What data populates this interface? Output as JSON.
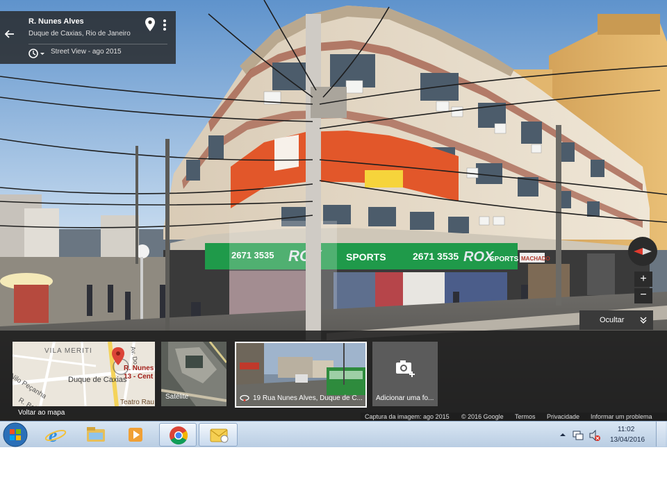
{
  "header": {
    "back_icon": "arrow-left-icon",
    "title": "R. Nunes Alves",
    "subtitle": "Duque de Caxias, Rio de Janeiro",
    "date_label": "Street View - ago 2015",
    "pin_icon": "location-pin-icon",
    "more_icon": "more-vertical-icon",
    "history_icon": "clock-history-icon"
  },
  "storefront": {
    "sign_left_phone": "2671 3535",
    "sign_brand": "ROX",
    "sign_sports": "SPORTS",
    "sign_phone": "2671 3535",
    "sign_right_brand": "ROX",
    "sign_right_sports": "SPORTS",
    "shop_small_sign": "MACHADO"
  },
  "controls": {
    "zoom_in": "+",
    "zoom_out": "−",
    "hide_label": "Ocultar"
  },
  "thumbnails": {
    "map": {
      "street_1": "VILA MERITI",
      "street_2": "Nilo Peçanha",
      "street_3": "Av. Do",
      "place_1": "R. Nunes",
      "place_2": "13 - Cent",
      "place_3": "Duque de Caxias",
      "place_4": "Teatro Rau",
      "street_4": "R. Bel",
      "back_label": "Voltar ao mapa"
    },
    "satellite_label": "Satélite",
    "photo_label": "19 Rua Nunes Alves, Duque de C...",
    "add_photo_label": "Adicionar uma fo..."
  },
  "attribution": {
    "capture": "Captura da imagem: ago 2015",
    "copyright": "© 2016 Google",
    "terms": "Termos",
    "privacy": "Privacidade",
    "report": "Informar um problema"
  },
  "taskbar": {
    "time": "11:02",
    "date": "13/04/2016",
    "apps": [
      "start-orb",
      "internet-explorer",
      "file-explorer",
      "media-player",
      "chrome",
      "outlook"
    ]
  },
  "colors": {
    "sign_green": "#1f9a4a",
    "sign_orange": "#e2572a",
    "overlay_dark": "#262626",
    "compass_red": "#e03b2f",
    "taskbar_top": "#d9e6f3"
  }
}
